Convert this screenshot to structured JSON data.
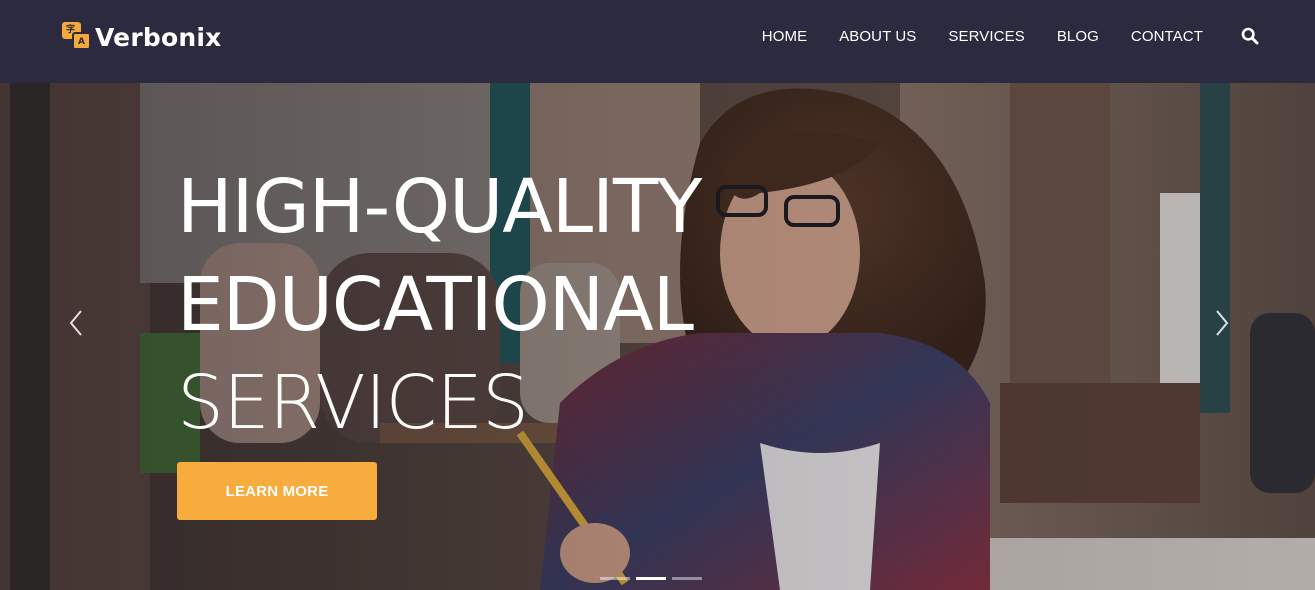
{
  "brand": {
    "name": "Verbonix",
    "logo_icon": "translate-logo-icon",
    "glyph_a": "字",
    "glyph_b": "A",
    "accent": "#f7ac3d"
  },
  "nav": {
    "items": [
      {
        "label": "HOME"
      },
      {
        "label": "ABOUT US"
      },
      {
        "label": "SERVICES"
      },
      {
        "label": "BLOG"
      },
      {
        "label": "CONTACT"
      }
    ],
    "search_icon": "search-icon"
  },
  "hero": {
    "title_line1": "HIGH-QUALITY",
    "title_line2": "EDUCATIONAL",
    "title_line3": "SERVICES",
    "cta_label": "LEARN MORE",
    "prev_icon": "chevron-left-icon",
    "next_icon": "chevron-right-icon",
    "slide_count": 3,
    "active_slide": 2
  },
  "colors": {
    "header_bg": "#2b2a3f",
    "cta_bg": "#f7ac3d",
    "text": "#ffffff"
  }
}
